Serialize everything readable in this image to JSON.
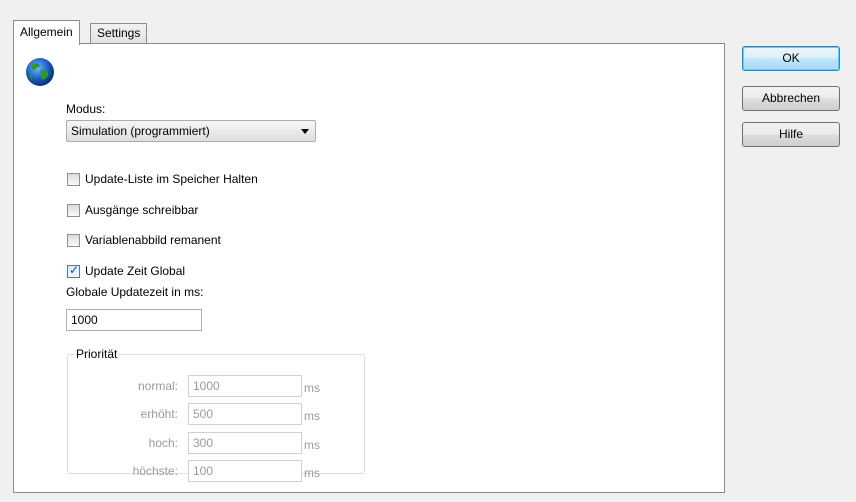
{
  "tabs": [
    {
      "label": "Allgemein",
      "active": true
    },
    {
      "label": "Settings",
      "active": false
    }
  ],
  "globe_icon": "globe-icon",
  "modus": {
    "label": "Modus:",
    "selected": "Simulation (programmiert)"
  },
  "checkboxes": [
    {
      "label": "Update-Liste im Speicher Halten",
      "checked": false
    },
    {
      "label": "Ausgänge schreibbar",
      "checked": false
    },
    {
      "label": "Variablenabbild remanent",
      "checked": false
    },
    {
      "label": "Update Zeit Global",
      "checked": true
    }
  ],
  "global_update": {
    "label": "Globale Updatezeit in ms:",
    "value": "1000"
  },
  "priority": {
    "legend": "Priorität",
    "unit": "ms",
    "rows": [
      {
        "label": "normal:",
        "value": "1000"
      },
      {
        "label": "erhöht:",
        "value": "500"
      },
      {
        "label": "hoch:",
        "value": "300"
      },
      {
        "label": "höchste:",
        "value": "100"
      }
    ]
  },
  "buttons": {
    "ok": "OK",
    "cancel": "Abbrechen",
    "help": "Hilfe"
  },
  "colors": {
    "window_bg": "#f0f0f0",
    "panel_bg": "#ffffff",
    "disabled_text": "#9a9a9a",
    "default_button_border": "#3c7fb1"
  }
}
